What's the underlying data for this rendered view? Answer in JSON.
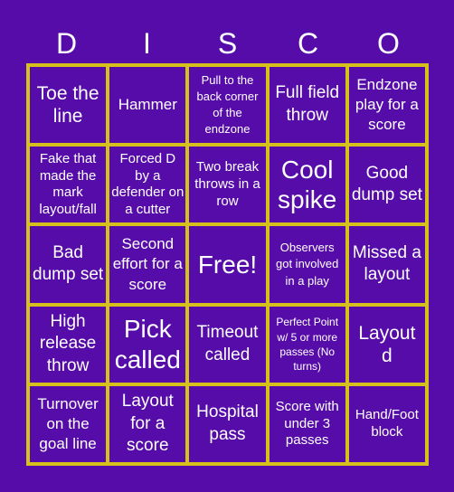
{
  "title_letters": [
    "D",
    "I",
    "S",
    "C",
    "O"
  ],
  "colors": {
    "background": "#560ca8",
    "grid_lines": "#d4c11c",
    "text": "#ffffff"
  },
  "cells": [
    [
      "Toe the line",
      "Hammer",
      "Pull to the back corner of the endzone",
      "Full field throw",
      "Endzone play for a score"
    ],
    [
      "Fake that made the mark layout/fall",
      "Forced D by a defender on a cutter",
      "Two break throws in a row",
      "Cool spike",
      "Good dump set"
    ],
    [
      "Bad dump set",
      "Second effort for a score",
      "Free!",
      "Observers got involved in a play",
      "Missed a layout"
    ],
    [
      "High release throw",
      "Pick called",
      "Timeout called",
      "Perfect Point w/ 5 or more passes (No turns)",
      "Layout d"
    ],
    [
      "Turnover on the goal line",
      "Layout for a score",
      "Hospital pass",
      "Score with under 3 passes",
      "Hand/Foot block"
    ]
  ]
}
